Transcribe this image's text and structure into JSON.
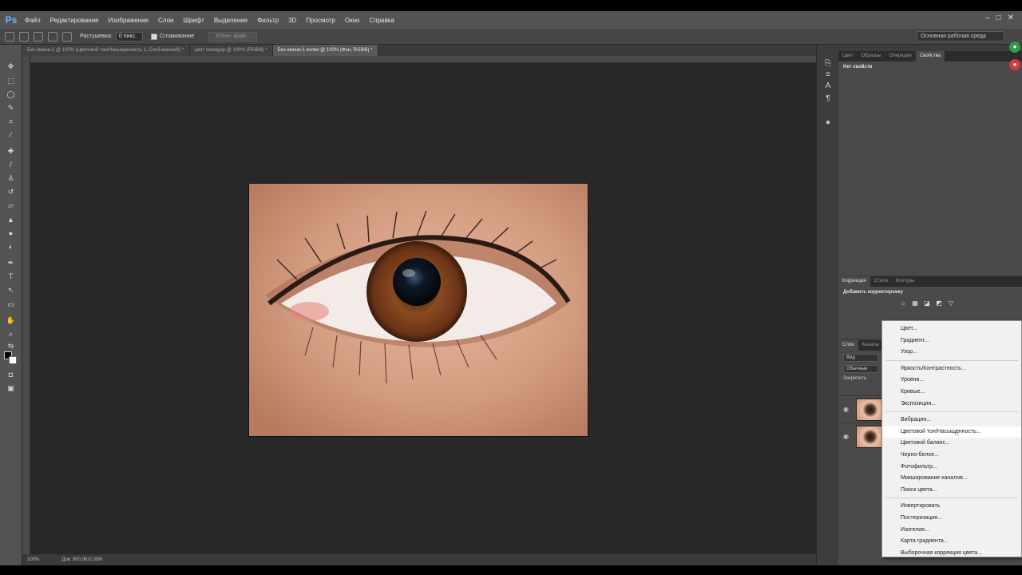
{
  "app": {
    "logo": "Ps"
  },
  "menu": [
    "Файл",
    "Редактирование",
    "Изображение",
    "Слои",
    "Шрифт",
    "Выделение",
    "Фильтр",
    "3D",
    "Просмотр",
    "Окно",
    "Справка"
  ],
  "window_controls": [
    "–",
    "□",
    "✕"
  ],
  "options": {
    "feather_label": "Растушевка:",
    "feather_value": "0 пикс.",
    "antialias_label": "Сглаживание",
    "refine_button": "Уточн. край...",
    "workspace": "Основная рабочая среда"
  },
  "document_tabs": [
    {
      "label": "Без имени-1 @ 100% (Цветовой тон/Насыщенность 1, Слой-маска/8) *"
    },
    {
      "label": "цвет глазадзр @ 100% (RGB/8) *"
    },
    {
      "label": "Без имени-1 копия @ 100% (Фон, RGB/8) *"
    }
  ],
  "status": {
    "zoom": "100%",
    "doc": "Док: 900,0K/2,00M"
  },
  "right_panel": {
    "top_tabs": [
      "Цвет",
      "Образцы",
      "Операции",
      "Свойства"
    ],
    "top_title": "Нет свойств",
    "adj_tabs": [
      "Коррекция",
      "Стили",
      "Контуры"
    ],
    "adj_title": "Добавить корректировку",
    "layer_tabs": [
      "Слои",
      "Каналы"
    ],
    "layer_kind": "Вид",
    "blend_mode": "Обычные",
    "lock_label": "Закрепить:"
  },
  "dropdown": {
    "group1": [
      "Цвет...",
      "Градиент...",
      "Узор..."
    ],
    "group2": [
      "Яркость/Контрастность...",
      "Уровни...",
      "Кривые...",
      "Экспозиция..."
    ],
    "group3": [
      "Вибрация...",
      "Цветовой тон/Насыщенность...",
      "Цветовой баланс...",
      "Черно-белое...",
      "Фотофильтр...",
      "Микширование каналов...",
      "Поиск цвета..."
    ],
    "group4": [
      "Инвертировать",
      "Постеризация...",
      "Изогелия...",
      "Карта градиента...",
      "Выборочная коррекция цвета..."
    ]
  }
}
